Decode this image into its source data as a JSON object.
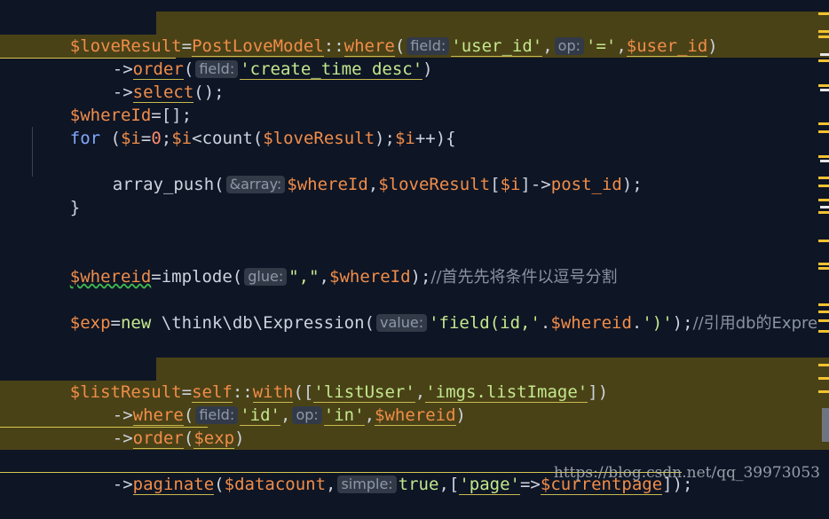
{
  "code": {
    "l1": {
      "var": "$loveResult",
      "eq": "=",
      "cls": "PostLoveModel",
      "sep": "::",
      "fn": "where",
      "open": "(",
      "hint1": "field:",
      "arg1": "'user_id'",
      "c1": ",",
      "hint2": "op:",
      "arg2": "'='",
      "c2": ",",
      "arg3": "$user_id",
      "close": ")"
    },
    "l2": {
      "arrow": "->",
      "fn": "order",
      "open": "(",
      "hint": "field:",
      "arg": "'create_time desc'",
      "close": ")"
    },
    "l3": {
      "arrow": "->",
      "fn": "select",
      "tail": "();"
    },
    "l4": {
      "var": "$whereId",
      "rest": "=[];"
    },
    "l5": {
      "kw": "for",
      "t1": " (",
      "v1": "$i",
      "t2": "=",
      "n0": "0",
      "t3": ";",
      "v2": "$i",
      "t4": "<count(",
      "v3": "$loveResult",
      "t5": ");",
      "v4": "$i",
      "t6": "++){"
    },
    "l6": {
      "fn": "array_push(",
      "hint": "&array:",
      "v1": "$whereId",
      "c": ",",
      "v2": "$loveResult",
      "b1": "[",
      "v3": "$i",
      "b2": "]->",
      "prop": "post_id",
      "end": ");"
    },
    "l7": {
      "text": "}"
    },
    "l8": {
      "var": "$whereid",
      "t1": "=implode(",
      "hint": "glue:",
      "s1": "\",\"",
      "c": ",",
      "v2": "$whereId",
      "t2": ");",
      "comment": "//首先先将条件以逗号分割"
    },
    "l9": {
      "var": "$exp",
      "t1": "=",
      "kw": "new",
      "t2": " \\think\\db\\Expression(",
      "hint": "value:",
      "s1": "'field(id,'",
      "t3": ".",
      "v2": "$whereid",
      "t4": ".",
      "s2": "')'",
      "t5": ");",
      "comment": "//引用db的Expre"
    },
    "l10": {
      "var": "$listResult",
      "eq": "=",
      "slf": "self",
      "sep": "::",
      "fn": "with",
      "t1": "([",
      "s1": "'listUser'",
      "c": ",",
      "s2": "'imgs.listImage'",
      "t2": "])"
    },
    "l11": {
      "arrow": "->",
      "fn": "where",
      "open": "(",
      "hint1": "field:",
      "s1": "'id'",
      "c1": ",",
      "hint2": "op:",
      "s2": "'in'",
      "c2": ",",
      "v": "$whereid",
      "close": ")"
    },
    "l12": {
      "arrow": "->",
      "fn": "order",
      "open": "(",
      "v": "$exp",
      "close": ")"
    },
    "l13": {
      "arrow": "->",
      "fn": "paginate",
      "open": "(",
      "v1": "$datacount",
      "c1": ",",
      "hint": "simple:",
      "kw": "true",
      "c2": ",",
      "b": "[",
      "s1": "'page'",
      "op": "=>",
      "v2": "$currentpage",
      "end": "]);"
    }
  },
  "watermark": "https://blog.csdn.net/qq_39973053",
  "colors": {
    "background": "#0e1525",
    "selection": "#4a4217",
    "variable": "#f08d49",
    "string": "#c3e88d",
    "marker": "#f2c230"
  }
}
